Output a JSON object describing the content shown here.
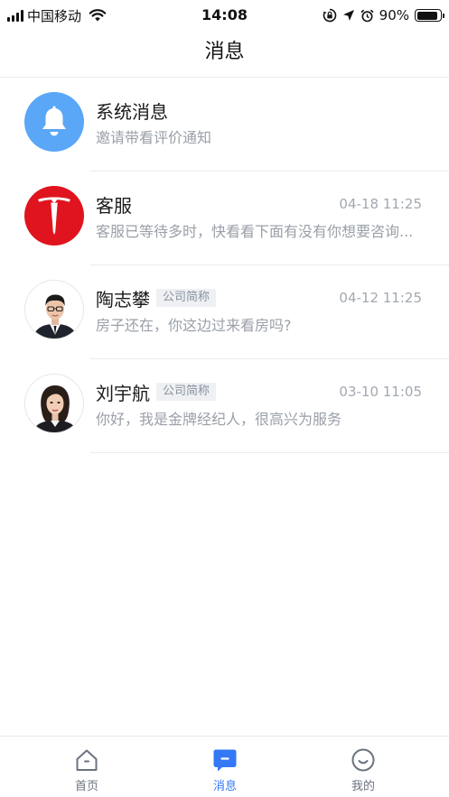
{
  "status_bar": {
    "carrier": "中国移动",
    "time": "14:08",
    "battery_percent": "90%",
    "battery_level": 0.9
  },
  "header": {
    "title": "消息"
  },
  "messages": [
    {
      "name": "系统消息",
      "tag": "",
      "time": "",
      "preview": "邀请带看评价通知",
      "avatar": "bell-icon"
    },
    {
      "name": "客服",
      "tag": "",
      "time": "04-18 11:25",
      "preview": "客服已等待多时，快看看下面有没有你想要咨询...",
      "avatar": "tesla-logo"
    },
    {
      "name": "陶志攀",
      "tag": "公司简称",
      "time": "04-12 11:25",
      "preview": "房子还在，你这边过来看房吗?",
      "avatar": "male-agent-photo"
    },
    {
      "name": "刘宇航",
      "tag": "公司简称",
      "time": "03-10 11:05",
      "preview": "你好，我是金牌经纪人，很高兴为服务",
      "avatar": "female-agent-photo"
    }
  ],
  "tabs": [
    {
      "label": "首页",
      "icon": "home-icon",
      "active": false
    },
    {
      "label": "消息",
      "icon": "message-icon",
      "active": true
    },
    {
      "label": "我的",
      "icon": "smile-icon",
      "active": false
    }
  ],
  "colors": {
    "accent": "#3478f6",
    "bell_bg": "#5aa6f7",
    "tesla_red": "#e0141e",
    "muted_text": "#9aa0a8"
  }
}
